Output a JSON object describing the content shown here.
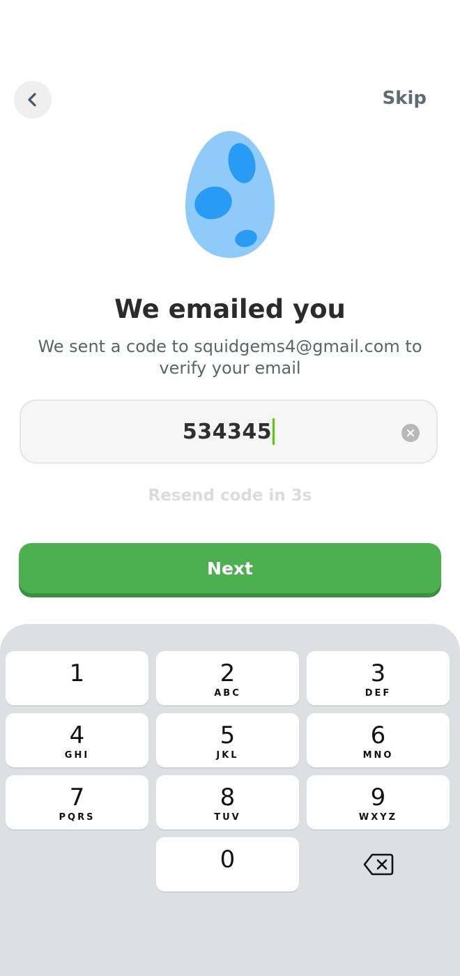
{
  "header": {
    "back_icon": "chevron-left-icon",
    "skip_label": "Skip"
  },
  "illustration": {
    "name": "egg-illustration",
    "colors": {
      "shell": "#8ecbfa",
      "spots": "#2a9bf5"
    }
  },
  "content": {
    "title": "We emailed you",
    "subtitle": "We sent a code to squidgems4@gmail.com to verify your email"
  },
  "code_input": {
    "value": "534345",
    "clear_icon": "clear-circle-icon"
  },
  "resend_text": "Resend code in 3s",
  "next_button": {
    "label": "Next",
    "color": "#4caf50"
  },
  "keypad": {
    "keys": [
      {
        "digit": "1",
        "letters": ""
      },
      {
        "digit": "2",
        "letters": "ABC"
      },
      {
        "digit": "3",
        "letters": "DEF"
      },
      {
        "digit": "4",
        "letters": "GHI"
      },
      {
        "digit": "5",
        "letters": "JKL"
      },
      {
        "digit": "6",
        "letters": "MNO"
      },
      {
        "digit": "7",
        "letters": "PQRS"
      },
      {
        "digit": "8",
        "letters": "TUV"
      },
      {
        "digit": "9",
        "letters": "WXYZ"
      },
      {
        "digit": "0",
        "letters": ""
      }
    ],
    "delete_icon": "backspace-icon"
  }
}
